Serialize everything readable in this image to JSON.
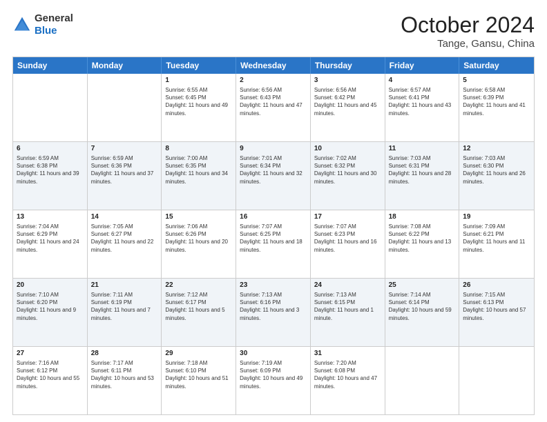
{
  "logo": {
    "line1": "General",
    "line2": "Blue"
  },
  "title": "October 2024",
  "subtitle": "Tange, Gansu, China",
  "days": [
    "Sunday",
    "Monday",
    "Tuesday",
    "Wednesday",
    "Thursday",
    "Friday",
    "Saturday"
  ],
  "weeks": [
    [
      {
        "day": "",
        "sunrise": "",
        "sunset": "",
        "daylight": ""
      },
      {
        "day": "",
        "sunrise": "",
        "sunset": "",
        "daylight": ""
      },
      {
        "day": "1",
        "sunrise": "Sunrise: 6:55 AM",
        "sunset": "Sunset: 6:45 PM",
        "daylight": "Daylight: 11 hours and 49 minutes."
      },
      {
        "day": "2",
        "sunrise": "Sunrise: 6:56 AM",
        "sunset": "Sunset: 6:43 PM",
        "daylight": "Daylight: 11 hours and 47 minutes."
      },
      {
        "day": "3",
        "sunrise": "Sunrise: 6:56 AM",
        "sunset": "Sunset: 6:42 PM",
        "daylight": "Daylight: 11 hours and 45 minutes."
      },
      {
        "day": "4",
        "sunrise": "Sunrise: 6:57 AM",
        "sunset": "Sunset: 6:41 PM",
        "daylight": "Daylight: 11 hours and 43 minutes."
      },
      {
        "day": "5",
        "sunrise": "Sunrise: 6:58 AM",
        "sunset": "Sunset: 6:39 PM",
        "daylight": "Daylight: 11 hours and 41 minutes."
      }
    ],
    [
      {
        "day": "6",
        "sunrise": "Sunrise: 6:59 AM",
        "sunset": "Sunset: 6:38 PM",
        "daylight": "Daylight: 11 hours and 39 minutes."
      },
      {
        "day": "7",
        "sunrise": "Sunrise: 6:59 AM",
        "sunset": "Sunset: 6:36 PM",
        "daylight": "Daylight: 11 hours and 37 minutes."
      },
      {
        "day": "8",
        "sunrise": "Sunrise: 7:00 AM",
        "sunset": "Sunset: 6:35 PM",
        "daylight": "Daylight: 11 hours and 34 minutes."
      },
      {
        "day": "9",
        "sunrise": "Sunrise: 7:01 AM",
        "sunset": "Sunset: 6:34 PM",
        "daylight": "Daylight: 11 hours and 32 minutes."
      },
      {
        "day": "10",
        "sunrise": "Sunrise: 7:02 AM",
        "sunset": "Sunset: 6:32 PM",
        "daylight": "Daylight: 11 hours and 30 minutes."
      },
      {
        "day": "11",
        "sunrise": "Sunrise: 7:03 AM",
        "sunset": "Sunset: 6:31 PM",
        "daylight": "Daylight: 11 hours and 28 minutes."
      },
      {
        "day": "12",
        "sunrise": "Sunrise: 7:03 AM",
        "sunset": "Sunset: 6:30 PM",
        "daylight": "Daylight: 11 hours and 26 minutes."
      }
    ],
    [
      {
        "day": "13",
        "sunrise": "Sunrise: 7:04 AM",
        "sunset": "Sunset: 6:29 PM",
        "daylight": "Daylight: 11 hours and 24 minutes."
      },
      {
        "day": "14",
        "sunrise": "Sunrise: 7:05 AM",
        "sunset": "Sunset: 6:27 PM",
        "daylight": "Daylight: 11 hours and 22 minutes."
      },
      {
        "day": "15",
        "sunrise": "Sunrise: 7:06 AM",
        "sunset": "Sunset: 6:26 PM",
        "daylight": "Daylight: 11 hours and 20 minutes."
      },
      {
        "day": "16",
        "sunrise": "Sunrise: 7:07 AM",
        "sunset": "Sunset: 6:25 PM",
        "daylight": "Daylight: 11 hours and 18 minutes."
      },
      {
        "day": "17",
        "sunrise": "Sunrise: 7:07 AM",
        "sunset": "Sunset: 6:23 PM",
        "daylight": "Daylight: 11 hours and 16 minutes."
      },
      {
        "day": "18",
        "sunrise": "Sunrise: 7:08 AM",
        "sunset": "Sunset: 6:22 PM",
        "daylight": "Daylight: 11 hours and 13 minutes."
      },
      {
        "day": "19",
        "sunrise": "Sunrise: 7:09 AM",
        "sunset": "Sunset: 6:21 PM",
        "daylight": "Daylight: 11 hours and 11 minutes."
      }
    ],
    [
      {
        "day": "20",
        "sunrise": "Sunrise: 7:10 AM",
        "sunset": "Sunset: 6:20 PM",
        "daylight": "Daylight: 11 hours and 9 minutes."
      },
      {
        "day": "21",
        "sunrise": "Sunrise: 7:11 AM",
        "sunset": "Sunset: 6:19 PM",
        "daylight": "Daylight: 11 hours and 7 minutes."
      },
      {
        "day": "22",
        "sunrise": "Sunrise: 7:12 AM",
        "sunset": "Sunset: 6:17 PM",
        "daylight": "Daylight: 11 hours and 5 minutes."
      },
      {
        "day": "23",
        "sunrise": "Sunrise: 7:13 AM",
        "sunset": "Sunset: 6:16 PM",
        "daylight": "Daylight: 11 hours and 3 minutes."
      },
      {
        "day": "24",
        "sunrise": "Sunrise: 7:13 AM",
        "sunset": "Sunset: 6:15 PM",
        "daylight": "Daylight: 11 hours and 1 minute."
      },
      {
        "day": "25",
        "sunrise": "Sunrise: 7:14 AM",
        "sunset": "Sunset: 6:14 PM",
        "daylight": "Daylight: 10 hours and 59 minutes."
      },
      {
        "day": "26",
        "sunrise": "Sunrise: 7:15 AM",
        "sunset": "Sunset: 6:13 PM",
        "daylight": "Daylight: 10 hours and 57 minutes."
      }
    ],
    [
      {
        "day": "27",
        "sunrise": "Sunrise: 7:16 AM",
        "sunset": "Sunset: 6:12 PM",
        "daylight": "Daylight: 10 hours and 55 minutes."
      },
      {
        "day": "28",
        "sunrise": "Sunrise: 7:17 AM",
        "sunset": "Sunset: 6:11 PM",
        "daylight": "Daylight: 10 hours and 53 minutes."
      },
      {
        "day": "29",
        "sunrise": "Sunrise: 7:18 AM",
        "sunset": "Sunset: 6:10 PM",
        "daylight": "Daylight: 10 hours and 51 minutes."
      },
      {
        "day": "30",
        "sunrise": "Sunrise: 7:19 AM",
        "sunset": "Sunset: 6:09 PM",
        "daylight": "Daylight: 10 hours and 49 minutes."
      },
      {
        "day": "31",
        "sunrise": "Sunrise: 7:20 AM",
        "sunset": "Sunset: 6:08 PM",
        "daylight": "Daylight: 10 hours and 47 minutes."
      },
      {
        "day": "",
        "sunrise": "",
        "sunset": "",
        "daylight": ""
      },
      {
        "day": "",
        "sunrise": "",
        "sunset": "",
        "daylight": ""
      }
    ]
  ]
}
